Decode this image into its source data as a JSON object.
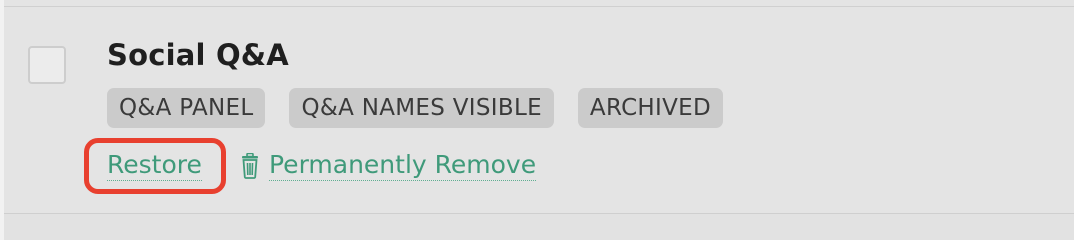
{
  "item": {
    "title": "Social Q&A",
    "tags": [
      "Q&A PANEL",
      "Q&A NAMES VISIBLE",
      "ARCHIVED"
    ]
  },
  "actions": {
    "restore_label": "Restore",
    "remove_label": "Permanently Remove",
    "remove_icon": "trash-icon"
  },
  "colors": {
    "link": "#3f9a7a",
    "highlight": "#e8402f",
    "tag_bg": "#cbcbcb",
    "background": "#e4e4e4"
  }
}
